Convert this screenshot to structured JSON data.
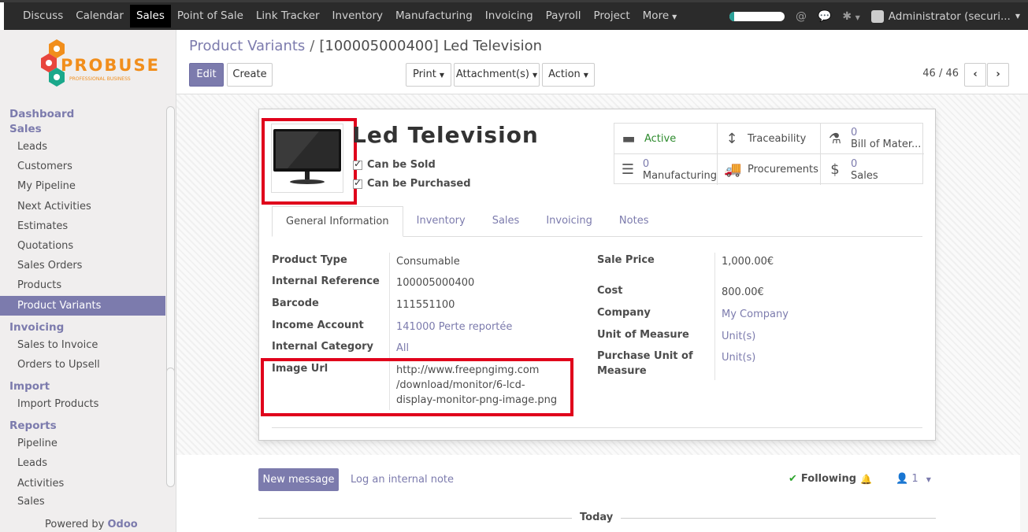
{
  "navbar": {
    "menu": [
      "Discuss",
      "Calendar",
      "Sales",
      "Point of Sale",
      "Link Tracker",
      "Inventory",
      "Manufacturing",
      "Invoicing",
      "Payroll",
      "Project",
      "More"
    ],
    "active": "Sales",
    "progress": 0.08,
    "user": "Administrator (securi..."
  },
  "logo": {
    "word": "PROBUSE",
    "sub": "PROFESSIONAL BUSINESS"
  },
  "sidebar": {
    "sections": [
      {
        "title": "Dashboard",
        "items": []
      },
      {
        "title": "Sales",
        "items": [
          "Leads",
          "Customers",
          "My Pipeline",
          "Next Activities",
          "Estimates",
          "Quotations",
          "Sales Orders",
          "Products",
          "Product Variants"
        ]
      },
      {
        "title": "Invoicing",
        "items": [
          "Sales to Invoice",
          "Orders to Upsell"
        ]
      },
      {
        "title": "Import",
        "items": [
          "Import Products"
        ]
      },
      {
        "title": "Reports",
        "items": [
          "Pipeline",
          "Leads",
          "Activities",
          "Sales"
        ]
      }
    ],
    "active_item": "Product Variants",
    "powered_by": "Powered by",
    "powered_brand": "Odoo"
  },
  "control": {
    "breadcrumb_parent": "Product Variants",
    "breadcrumb_sep": "/",
    "breadcrumb_current": "[100005000400] Led Television",
    "edit_label": "Edit",
    "create_label": "Create",
    "print_label": "Print",
    "attachments_label": "Attachment(s)",
    "action_label": "Action",
    "pager": "46 / 46"
  },
  "product": {
    "name": "Led Television",
    "can_be_sold": "Can be Sold",
    "can_be_purchased": "Can be Purchased"
  },
  "smart_buttons": {
    "active": "Active",
    "traceability": "Traceability",
    "bom_count": "0",
    "bom_label": "Bill of Mater...",
    "mfg_count": "0",
    "mfg_label": "Manufacturing",
    "procurements": "Procurements",
    "sales_count": "0",
    "sales_label": "Sales"
  },
  "tabs": [
    "General Information",
    "Inventory",
    "Sales",
    "Invoicing",
    "Notes"
  ],
  "active_tab": "General Information",
  "fields_left": [
    {
      "label": "Product Type",
      "value": "Consumable"
    },
    {
      "label": "Internal Reference",
      "value": "100005000400"
    },
    {
      "label": "Barcode",
      "value": "111551100"
    },
    {
      "label": "Income Account",
      "value": "141000 Perte reportée"
    },
    {
      "label": "Internal Category",
      "value": "All"
    },
    {
      "label": "Image Url",
      "value_lines": [
        "http://www.freepngimg.com",
        "/download/monitor/6-lcd-",
        "display-monitor-png-image.png"
      ]
    }
  ],
  "fields_right": [
    {
      "label": "Sale Price",
      "value": "1,000.00€"
    },
    {
      "label": "Cost",
      "value": "800.00€"
    },
    {
      "label": "Company",
      "value": "My Company"
    },
    {
      "label": "Unit of Measure",
      "value": "Unit(s)"
    },
    {
      "label_lines": [
        "Purchase Unit of",
        "Measure"
      ],
      "value": "Unit(s)"
    }
  ],
  "chatter": {
    "new_message": "New message",
    "log_note": "Log an internal note",
    "following": "Following",
    "followers": "1",
    "today": "Today"
  },
  "colors": {
    "accent": "#7c7bad",
    "navbar": "#2b2b2b",
    "highlight": "#e0001b"
  }
}
